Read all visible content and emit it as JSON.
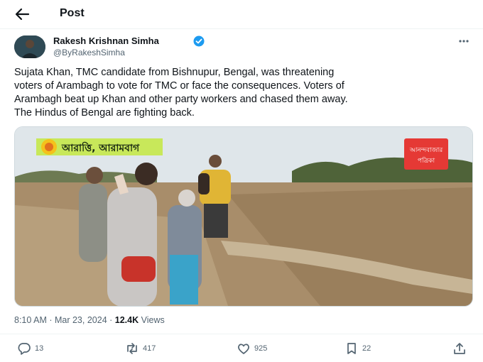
{
  "header": {
    "title": "Post"
  },
  "author": {
    "name": "Rakesh Krishnan Simha",
    "handle": "@ByRakeshSimha"
  },
  "tweet": {
    "lines": [
      "Sujata Khan, TMC candidate from Bishnupur, Bengal, was threatening",
      "voters of Arambagh to vote for TMC or face the consequences.  Voters of",
      "Arambagh beat up Khan and other party workers and chased them away.",
      "The Hindus of Bengal are fighting back."
    ]
  },
  "media": {
    "location_caption": "আরাত্তি, আরামবাগ",
    "logo_text": [
      "আনন্দবাজার",
      "পত্রিকা"
    ]
  },
  "meta": {
    "time": "8:10 AM",
    "separator": " · ",
    "date": "Mar 23, 2024",
    "views_count": "12.4K",
    "views_label": " Views"
  },
  "actions": {
    "replies": "13",
    "reposts": "417",
    "likes": "925",
    "bookmarks": "22"
  },
  "colors": {
    "verified": "#1d9bf0",
    "logo_bg": "#e53935",
    "caption_bg": "#c8e85a"
  },
  "icons": [
    "back-arrow-icon",
    "verified-badge-icon",
    "more-icon",
    "reply-icon",
    "repost-icon",
    "like-icon",
    "bookmark-icon",
    "share-icon"
  ]
}
